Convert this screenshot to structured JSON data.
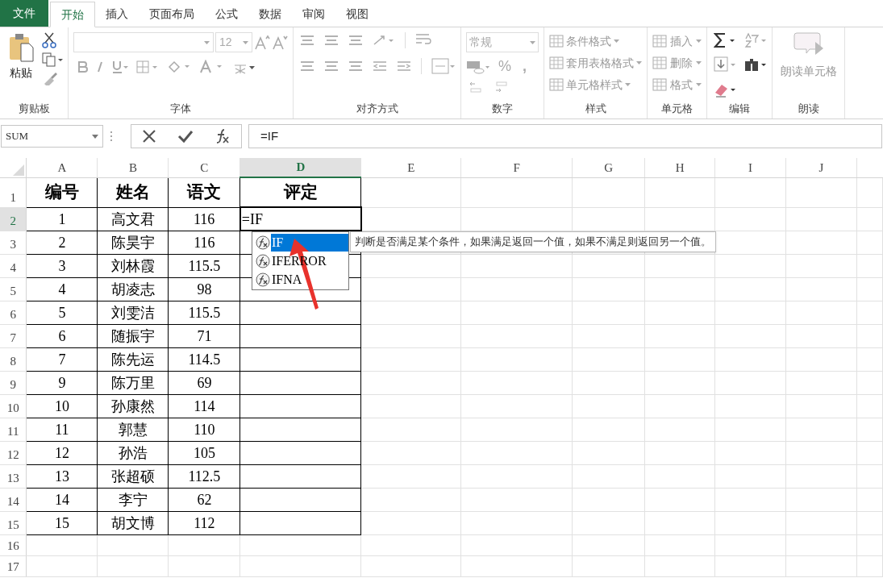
{
  "menu_tabs": [
    {
      "label": "文件",
      "kind": "file",
      "selected": false
    },
    {
      "label": "开始",
      "kind": "tab",
      "selected": true
    },
    {
      "label": "插入",
      "kind": "tab",
      "selected": false
    },
    {
      "label": "页面布局",
      "kind": "tab",
      "selected": false
    },
    {
      "label": "公式",
      "kind": "tab",
      "selected": false
    },
    {
      "label": "数据",
      "kind": "tab",
      "selected": false
    },
    {
      "label": "审阅",
      "kind": "tab",
      "selected": false
    },
    {
      "label": "视图",
      "kind": "tab",
      "selected": false
    }
  ],
  "ribbon": {
    "clipboard": {
      "title": "剪贴板",
      "paste_label": "粘贴"
    },
    "font": {
      "title": "字体",
      "font_size": "12"
    },
    "alignment": {
      "title": "对齐方式"
    },
    "number": {
      "title": "数字",
      "format": "常规",
      "percent": "%",
      "comma": ","
    },
    "styles": {
      "title": "样式",
      "items": [
        "条件格式",
        "套用表格格式",
        "单元格样式"
      ]
    },
    "cells": {
      "title": "单元格",
      "items": [
        "插入",
        "删除",
        "格式"
      ]
    },
    "editing": {
      "title": "编辑"
    },
    "read_aloud": {
      "title": "朗读",
      "button": "朗读单元格"
    }
  },
  "name_box": "SUM",
  "formula": "=IF",
  "sheet": {
    "columns": [
      {
        "label": "A",
        "selected": false
      },
      {
        "label": "B",
        "selected": false
      },
      {
        "label": "C",
        "selected": false
      },
      {
        "label": "D",
        "selected": true
      },
      {
        "label": "E",
        "selected": false
      },
      {
        "label": "F",
        "selected": false
      },
      {
        "label": "G",
        "selected": false
      },
      {
        "label": "H",
        "selected": false
      },
      {
        "label": "I",
        "selected": false
      },
      {
        "label": "J",
        "selected": false
      }
    ],
    "rows": [
      {
        "number": "1",
        "selected": false,
        "cells": [
          "编号",
          "姓名",
          "语文",
          "评定"
        ]
      },
      {
        "number": "2",
        "selected": true,
        "cells": [
          "1",
          "高文君",
          "116",
          "=IF"
        ]
      },
      {
        "number": "3",
        "selected": false,
        "cells": [
          "2",
          "陈昊宇",
          "116",
          ""
        ]
      },
      {
        "number": "4",
        "selected": false,
        "cells": [
          "3",
          "刘林霞",
          "115.5",
          ""
        ]
      },
      {
        "number": "5",
        "selected": false,
        "cells": [
          "4",
          "胡凌志",
          "98",
          ""
        ]
      },
      {
        "number": "6",
        "selected": false,
        "cells": [
          "5",
          "刘雯洁",
          "115.5",
          ""
        ]
      },
      {
        "number": "7",
        "selected": false,
        "cells": [
          "6",
          "随振宇",
          "71",
          ""
        ]
      },
      {
        "number": "8",
        "selected": false,
        "cells": [
          "7",
          "陈先运",
          "114.5",
          ""
        ]
      },
      {
        "number": "9",
        "selected": false,
        "cells": [
          "9",
          "陈万里",
          "69",
          ""
        ]
      },
      {
        "number": "10",
        "selected": false,
        "cells": [
          "10",
          "孙康然",
          "114",
          ""
        ]
      },
      {
        "number": "11",
        "selected": false,
        "cells": [
          "11",
          "郭慧",
          "110",
          ""
        ]
      },
      {
        "number": "12",
        "selected": false,
        "cells": [
          "12",
          "孙浩",
          "105",
          ""
        ]
      },
      {
        "number": "13",
        "selected": false,
        "cells": [
          "13",
          "张超硕",
          "112.5",
          ""
        ]
      },
      {
        "number": "14",
        "selected": false,
        "cells": [
          "14",
          "李宁",
          "62",
          ""
        ]
      },
      {
        "number": "15",
        "selected": false,
        "cells": [
          "15",
          "胡文博",
          "112",
          ""
        ]
      },
      {
        "number": "16",
        "selected": false,
        "cells": []
      },
      {
        "number": "17",
        "selected": false,
        "cells": []
      }
    ]
  },
  "autocomplete": {
    "items": [
      {
        "label": "IF",
        "selected": true
      },
      {
        "label": "IFERROR",
        "selected": false
      },
      {
        "label": "IFNA",
        "selected": false
      }
    ],
    "tooltip": "判断是否满足某个条件，如果满足返回一个值，如果不满足则返回另一个值。"
  }
}
